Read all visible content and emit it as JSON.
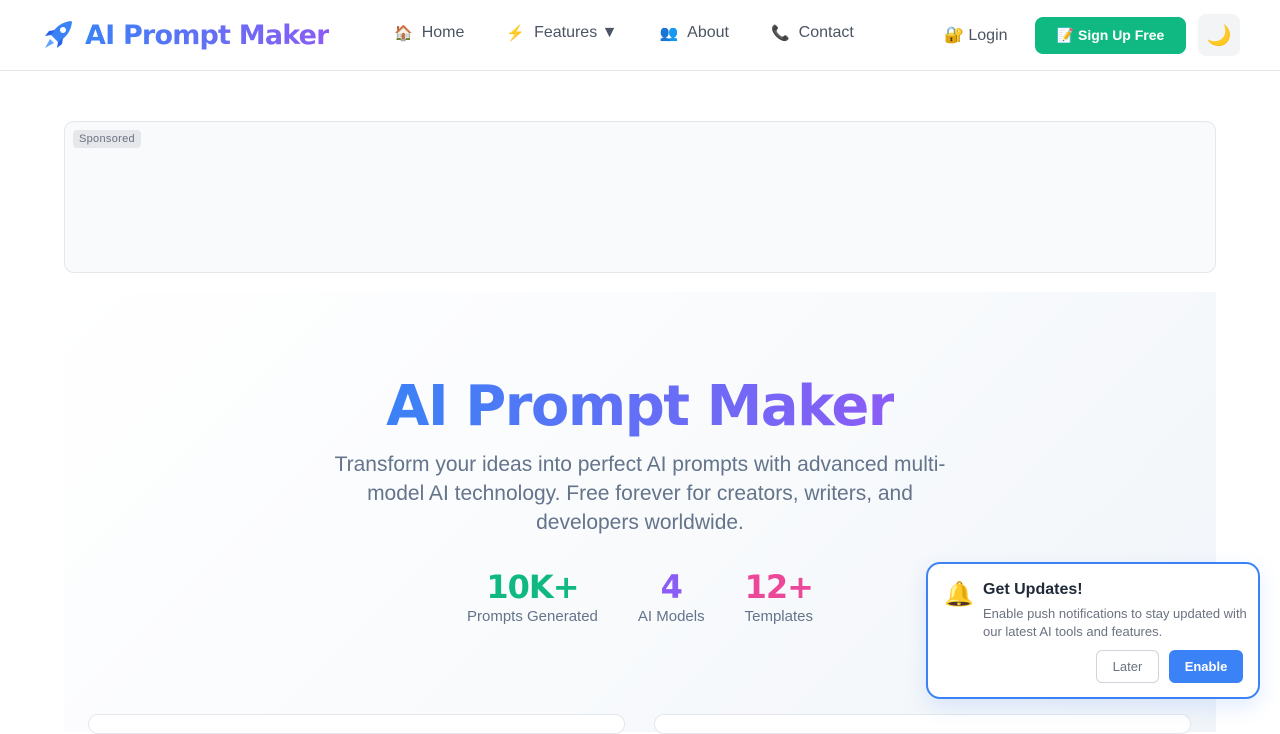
{
  "brand": {
    "name": "AI Prompt Maker",
    "icon": "rocket-icon"
  },
  "nav": {
    "links": [
      {
        "label": "Home",
        "icon": "🏠"
      },
      {
        "label": "Features ▼",
        "icon": "⚡"
      },
      {
        "label": "About",
        "icon": "👥"
      },
      {
        "label": "Contact",
        "icon": "📞"
      }
    ],
    "login": "🔐 Login",
    "signup": "📝 Sign Up Free",
    "theme_toggle": "🌙"
  },
  "ad": {
    "label": "Sponsored"
  },
  "hero": {
    "title": "AI Prompt Maker",
    "subtitle": "Transform your ideas into perfect AI prompts with advanced multi-model AI technology. Free forever for creators, writers, and developers worldwide.",
    "stats": [
      {
        "value": "10K+",
        "label": "Prompts Generated",
        "color": "#10b981"
      },
      {
        "value": "4",
        "label": "AI Models",
        "color": "#8b5cf6"
      },
      {
        "value": "12+",
        "label": "Templates",
        "color": "#ec4899"
      }
    ]
  },
  "notification": {
    "icon": "🔔",
    "title": "Get Updates!",
    "text": "Enable push notifications to stay updated with our latest AI tools and features.",
    "later": "Later",
    "enable": "Enable"
  },
  "colors": {
    "accent": "#3b82f6",
    "brand_gradient_end": "#8b5cf6",
    "success": "#10b981"
  }
}
